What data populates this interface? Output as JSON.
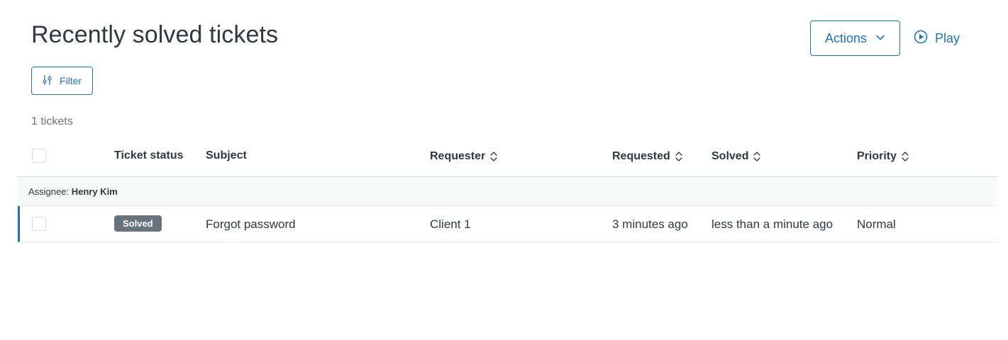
{
  "header": {
    "title": "Recently solved tickets",
    "actions_label": "Actions",
    "play_label": "Play"
  },
  "toolbar": {
    "filter_label": "Filter",
    "count_text": "1 tickets"
  },
  "table": {
    "columns": {
      "status": "Ticket status",
      "subject": "Subject",
      "requester": "Requester",
      "requested": "Requested",
      "solved": "Solved",
      "priority": "Priority"
    },
    "group": {
      "prefix": "Assignee:",
      "name": "Henry Kim"
    },
    "rows": [
      {
        "status": "Solved",
        "subject": "Forgot password",
        "requester": "Client 1",
        "requested": "3 minutes ago",
        "solved": "less than a minute ago",
        "priority": "Normal"
      }
    ]
  },
  "icons": {
    "actions": "chevron-down-icon",
    "play": "play-circle-icon",
    "filter": "sliders-icon",
    "sort": "sort-icon"
  },
  "colors": {
    "accent": "#1f73b7",
    "text": "#2f3941",
    "muted": "#68737d",
    "badge_solved": "#68737d"
  }
}
